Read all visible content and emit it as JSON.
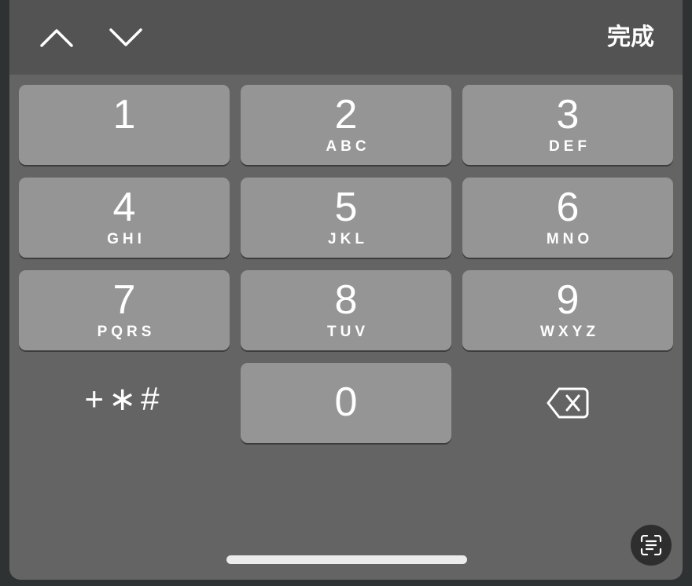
{
  "toolbar": {
    "done_label": "完成"
  },
  "keys": [
    {
      "digit": "1",
      "letters": ""
    },
    {
      "digit": "2",
      "letters": "ABC"
    },
    {
      "digit": "3",
      "letters": "DEF"
    },
    {
      "digit": "4",
      "letters": "GHI"
    },
    {
      "digit": "5",
      "letters": "JKL"
    },
    {
      "digit": "6",
      "letters": "MNO"
    },
    {
      "digit": "7",
      "letters": "PQRS"
    },
    {
      "digit": "8",
      "letters": "TUV"
    },
    {
      "digit": "9",
      "letters": "WXYZ"
    },
    {
      "digit": "0",
      "letters": ""
    }
  ],
  "symbols_label": "+∗#",
  "colors": {
    "keyboard_bg": "#646464",
    "toolbar_bg": "#535353",
    "key_bg": "#959595",
    "text": "#ffffff"
  },
  "icons": {
    "previous": "chevron-up-icon",
    "next": "chevron-down-icon",
    "delete": "delete-backspace-icon",
    "scan": "text-scan-icon"
  }
}
